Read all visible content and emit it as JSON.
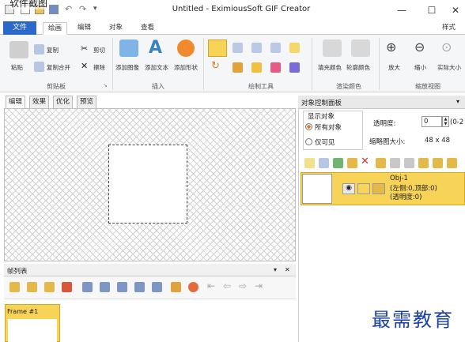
{
  "window": {
    "title": "Untitled - EximiousSoft GIF Creator",
    "overlay_text": "软件截图",
    "minimize": "—",
    "maximize": "☐",
    "close": "✕"
  },
  "ribbon_tabs": {
    "file": "文件",
    "draw": "绘画",
    "edit": "编辑",
    "object": "对象",
    "view": "查看",
    "style": "样式 ▾"
  },
  "clipboard": {
    "paste": "粘贴",
    "copy": "复制",
    "copy_merge": "复制合并",
    "cut": "剪切",
    "delete": "擦除",
    "group": "剪贴板"
  },
  "insert": {
    "add_image": "添加图像",
    "add_text": "添加文本",
    "add_shape": "添加形状",
    "group": "插入"
  },
  "draw_tools": {
    "group": "绘制工具"
  },
  "paint_color": {
    "fill": "填充颜色",
    "outline": "轮廓颜色",
    "group": "渲染颜色"
  },
  "zoom": {
    "zoom_in": "放大",
    "zoom_out": "缩小",
    "actual_size": "实际大小",
    "group": "缩放视图"
  },
  "work_tabs": [
    "编辑",
    "效果",
    "优化",
    "预览"
  ],
  "frames": {
    "title": "帧列表",
    "pin": "▾",
    "close": "✕",
    "items": [
      {
        "label": "Frame #1"
      }
    ]
  },
  "object_panel": {
    "title": "对象控制面板",
    "show_group": "显示对象",
    "all_objects": "所有对象",
    "visible_only": "仅可见",
    "opacity_label": "透明度:",
    "opacity_value": "0",
    "opacity_range": "(0-2",
    "thumb_size_label": "缩略图大小:",
    "thumb_size_value": "48 x 48",
    "object": {
      "name": "Obj-1",
      "position": "(左侧:0,顶部:0)",
      "opacity": "(透明度:0)"
    }
  },
  "watermark": "最需教育",
  "colors": {
    "accent": "#2b68c9",
    "selected": "#f7d357",
    "watermark": "#1a3fa8"
  }
}
